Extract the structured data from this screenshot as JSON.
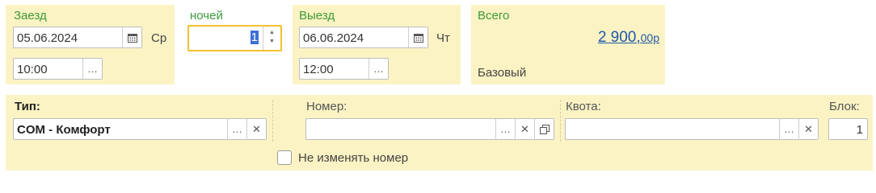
{
  "checkin": {
    "label": "Заезд",
    "date": "05.06.2024",
    "weekday": "Ср",
    "time": "10:00"
  },
  "nights": {
    "label": "ночей",
    "value": "1"
  },
  "checkout": {
    "label": "Выезд",
    "date": "06.06.2024",
    "weekday": "Чт",
    "time": "12:00"
  },
  "total": {
    "label": "Всего",
    "amount": "2 900,",
    "cents": "00р",
    "rate": "Базовый"
  },
  "room_type": {
    "label": "Тип:",
    "value": "COM - Комфорт"
  },
  "room_number": {
    "label": "Номер:",
    "value": "",
    "keep_label": "Не изменять номер",
    "keep_checked": false
  },
  "quota": {
    "label": "Квота:",
    "value": ""
  },
  "block": {
    "label": "Блок:",
    "value": "1"
  },
  "icons": {
    "ellipsis": "…",
    "clear": "✕",
    "up": "▲",
    "down": "▼"
  },
  "colors": {
    "panel_bg": "#fbf3c4",
    "green_label": "#3c9a3c",
    "link": "#1f58a8",
    "focus": "#f2c12e"
  }
}
